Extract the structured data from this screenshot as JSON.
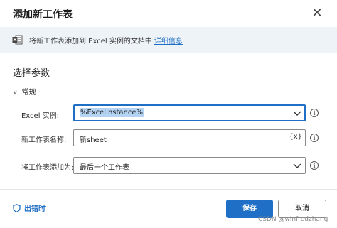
{
  "dialog": {
    "title": "添加新工作表"
  },
  "info": {
    "text": "将新工作表添加到 Excel 实例的文档中",
    "link": "详细信息"
  },
  "section": {
    "title": "选择参数",
    "group": "常规"
  },
  "fields": {
    "instance_label": "Excel 实例:",
    "instance_value": "%ExcelInstance%",
    "name_label": "新工作表名称:",
    "name_value": "新sheet",
    "name_var_button": "{x}",
    "position_label": "将工作表添加为:",
    "position_value": "最后一个工作表"
  },
  "footer": {
    "onerror": "出错时",
    "save": "保存",
    "cancel": "取消"
  },
  "watermark": "CSDN @winfredzhang",
  "colors": {
    "accent": "#1f6fc6",
    "banner_bg": "#eef3f8",
    "excel_green": "#1d7044"
  },
  "icons": {
    "close": "close-icon",
    "excel": "excel-icon",
    "chevron": "chevron-down-icon",
    "help": "help-icon",
    "shield": "shield-icon"
  }
}
